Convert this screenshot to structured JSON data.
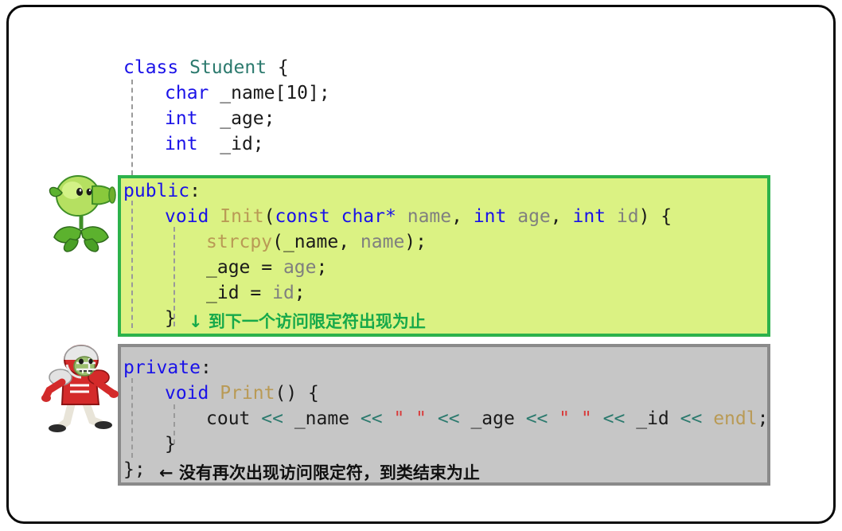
{
  "title": "C++ class access specifier scope illustration",
  "code": {
    "language": "cpp",
    "lines": [
      {
        "id": "l1",
        "indent": 0,
        "text": "class Student {"
      },
      {
        "id": "l2",
        "indent": 1,
        "text": "char _name[10];"
      },
      {
        "id": "l3",
        "indent": 1,
        "text": "int  _age;"
      },
      {
        "id": "l4",
        "indent": 1,
        "text": "int  _id;"
      },
      {
        "id": "l5",
        "indent": 0,
        "text": "public:"
      },
      {
        "id": "l6",
        "indent": 1,
        "text": "void Init(const char* name, int age, int id) {"
      },
      {
        "id": "l7",
        "indent": 2,
        "text": "strcpy(_name, name);"
      },
      {
        "id": "l8",
        "indent": 2,
        "text": "_age = age;"
      },
      {
        "id": "l9",
        "indent": 2,
        "text": "_id = id;"
      },
      {
        "id": "l10",
        "indent": 1,
        "text": "}"
      },
      {
        "id": "l11",
        "indent": 0,
        "text": "private:"
      },
      {
        "id": "l12",
        "indent": 1,
        "text": "void Print() {"
      },
      {
        "id": "l13",
        "indent": 2,
        "text": "cout << _name << \" \" << _age << \" \" << _id << endl;"
      },
      {
        "id": "l14",
        "indent": 1,
        "text": "}"
      },
      {
        "id": "l15",
        "indent": 0,
        "text": "};"
      }
    ],
    "tokens": {
      "class_kw": "class",
      "class_name": "Student",
      "open_brace": "{",
      "char_kw": "char",
      "name_member": "_name[10];",
      "int_kw": "int",
      "age_member": "_age;",
      "id_member": "_id;",
      "public_kw": "public",
      "private_kw": "private",
      "colon": ":",
      "void_kw": "void",
      "init_fn": "Init",
      "print_fn": "Print",
      "strcpy_fn": "strcpy",
      "const_kw": "const",
      "char_star": "char*",
      "param_name": "name",
      "param_age": "age",
      "param_id": "id",
      "cout": "cout",
      "endl": "endl",
      "shift_op": "<<",
      "space_string": "\" \"",
      "close_brace": "}",
      "close_class": "};"
    }
  },
  "annotations": {
    "public_scope": {
      "brace": "}",
      "arrow": "↓",
      "text": "到下一个访问限定符出现为止",
      "color": "#16a94a"
    },
    "private_scope": {
      "brace": "};",
      "arrow": "←",
      "text": "没有再次出现访问限定符，到类结束为止",
      "color": "#101010"
    }
  },
  "boxes": {
    "public_box": {
      "label": "public section highlight",
      "fill": "#dbf283",
      "border": "#2cb24b"
    },
    "private_box": {
      "label": "private section highlight",
      "fill": "#c6c6c6",
      "border": "#8a8a8a"
    }
  },
  "sprites": {
    "peashooter": {
      "name": "peashooter-sprite",
      "alt": "Peashooter plant"
    },
    "football_zombie": {
      "name": "football-zombie-sprite",
      "alt": "Football zombie"
    }
  },
  "frame": {
    "border_color": "#0a0a0a",
    "background": "#ffffff"
  }
}
